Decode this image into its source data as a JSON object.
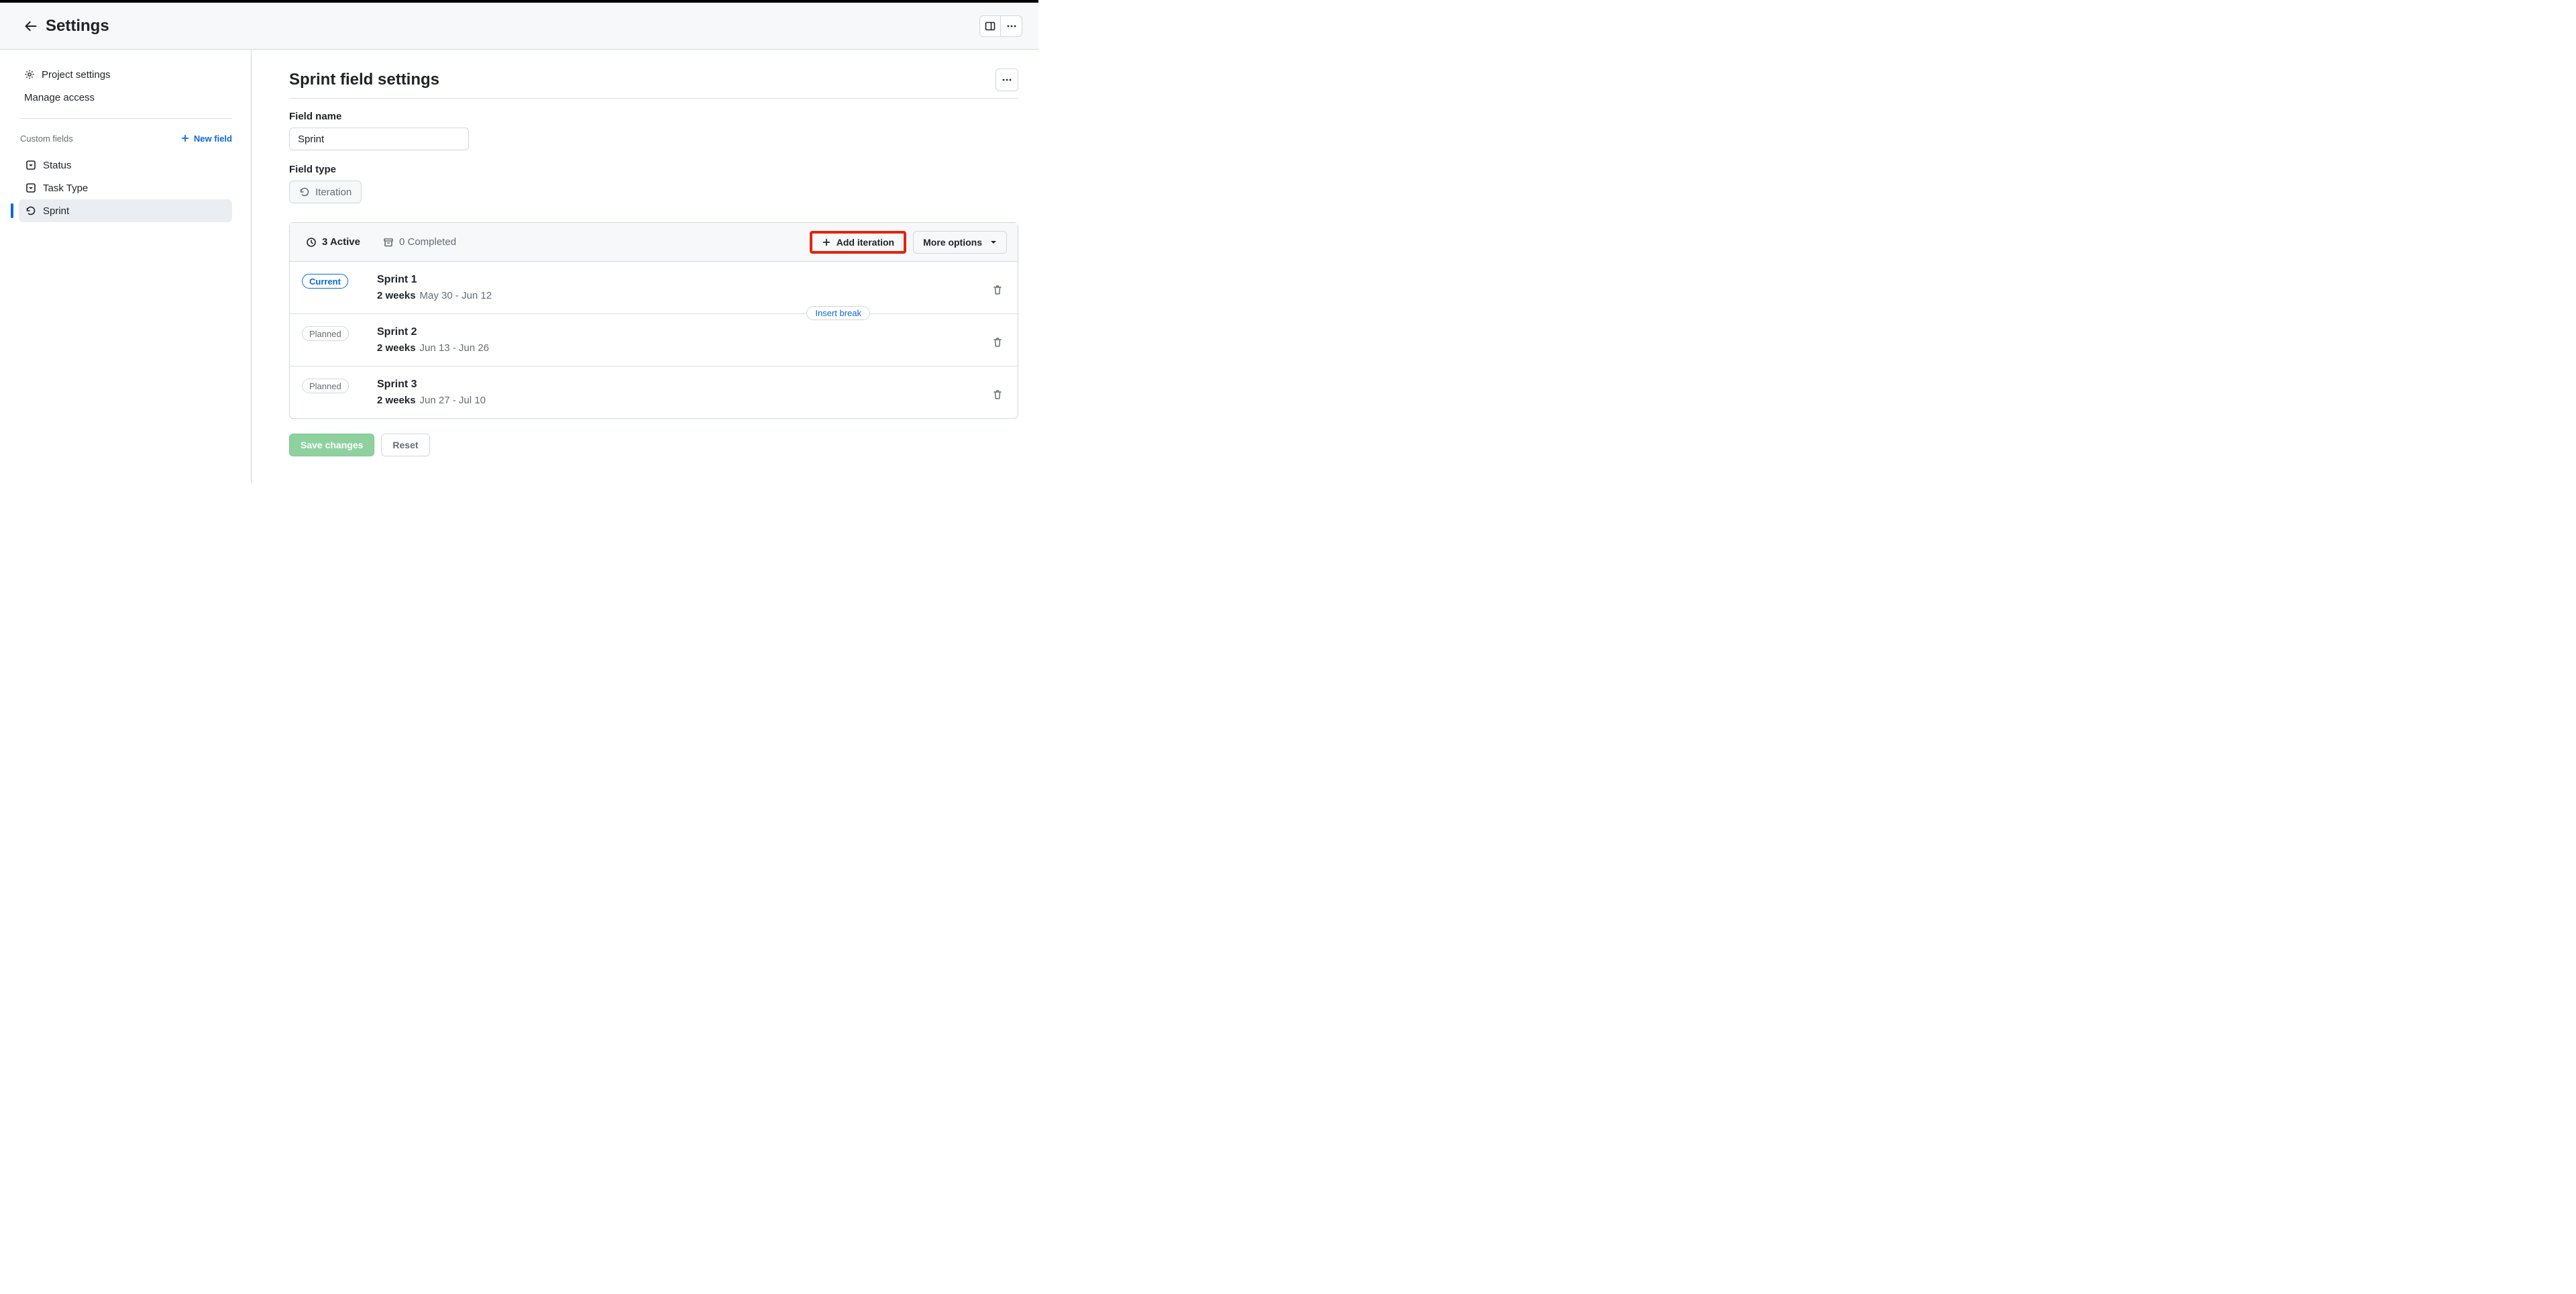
{
  "header": {
    "title": "Settings"
  },
  "sidebar": {
    "project_settings": "Project settings",
    "manage_access": "Manage access",
    "custom_fields_label": "Custom fields",
    "new_field_label": "New field",
    "fields": [
      {
        "label": "Status"
      },
      {
        "label": "Task Type"
      },
      {
        "label": "Sprint"
      }
    ]
  },
  "main": {
    "title": "Sprint field settings",
    "field_name_label": "Field name",
    "field_name_value": "Sprint",
    "field_type_label": "Field type",
    "field_type_value": "Iteration",
    "tabs": {
      "active": "3 Active",
      "completed": "0 Completed"
    },
    "add_iteration_label": "Add iteration",
    "more_options_label": "More options",
    "insert_break_label": "Insert break",
    "iterations": [
      {
        "badge": "Current",
        "badge_kind": "current",
        "name": "Sprint 1",
        "duration": "2 weeks",
        "range": "May 30 - Jun 12",
        "show_insert_break": false
      },
      {
        "badge": "Planned",
        "badge_kind": "planned",
        "name": "Sprint 2",
        "duration": "2 weeks",
        "range": "Jun 13 - Jun 26",
        "show_insert_break": true
      },
      {
        "badge": "Planned",
        "badge_kind": "planned",
        "name": "Sprint 3",
        "duration": "2 weeks",
        "range": "Jun 27 - Jul 10",
        "show_insert_break": false
      }
    ],
    "save_label": "Save changes",
    "reset_label": "Reset"
  }
}
